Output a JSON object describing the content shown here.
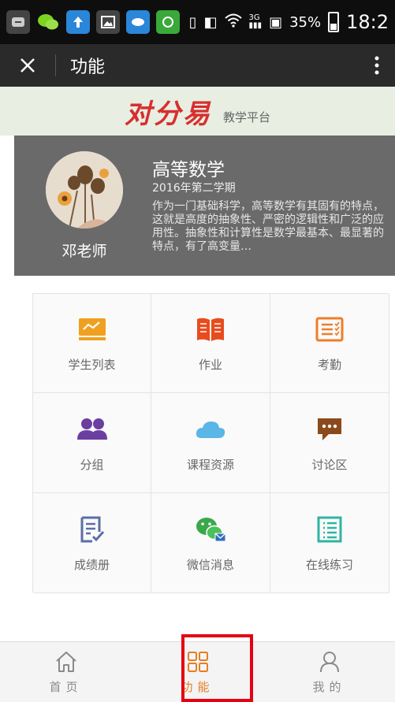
{
  "status_bar": {
    "signal_text": "3G",
    "battery": "35%",
    "time": "18:2"
  },
  "titlebar": {
    "title": "功能"
  },
  "banner": {
    "logo_text": "对分易",
    "subtitle": "教学平台"
  },
  "course": {
    "teacher": "邓老师",
    "title": "高等数学",
    "term": "2016年第二学期",
    "description": "作为一门基础科学，高等数学有其固有的特点，这就是高度的抽象性、严密的逻辑性和广泛的应用性。抽象性和计算性是数学最基本、最显著的特点，有了高变量…"
  },
  "grid": [
    {
      "label": "学生列表",
      "icon": "student-list-icon",
      "color": "#f0a020"
    },
    {
      "label": "作业",
      "icon": "homework-book-icon",
      "color": "#e84c1e"
    },
    {
      "label": "考勤",
      "icon": "attendance-icon",
      "color": "#ef7d2a"
    },
    {
      "label": "分组",
      "icon": "group-icon",
      "color": "#6b3fa0"
    },
    {
      "label": "课程资源",
      "icon": "cloud-icon",
      "color": "#5ab6e6"
    },
    {
      "label": "讨论区",
      "icon": "discussion-icon",
      "color": "#8b4a1c"
    },
    {
      "label": "成绩册",
      "icon": "gradebook-icon",
      "color": "#5b6fa6"
    },
    {
      "label": "微信消息",
      "icon": "wechat-icon",
      "color": "#3aa84a"
    },
    {
      "label": "在线练习",
      "icon": "online-practice-icon",
      "color": "#2fb5a0"
    }
  ],
  "tabs": [
    {
      "label": "首页",
      "icon": "home-icon"
    },
    {
      "label": "功能",
      "icon": "function-grid-icon",
      "active": true
    },
    {
      "label": "我的",
      "icon": "user-icon"
    }
  ]
}
